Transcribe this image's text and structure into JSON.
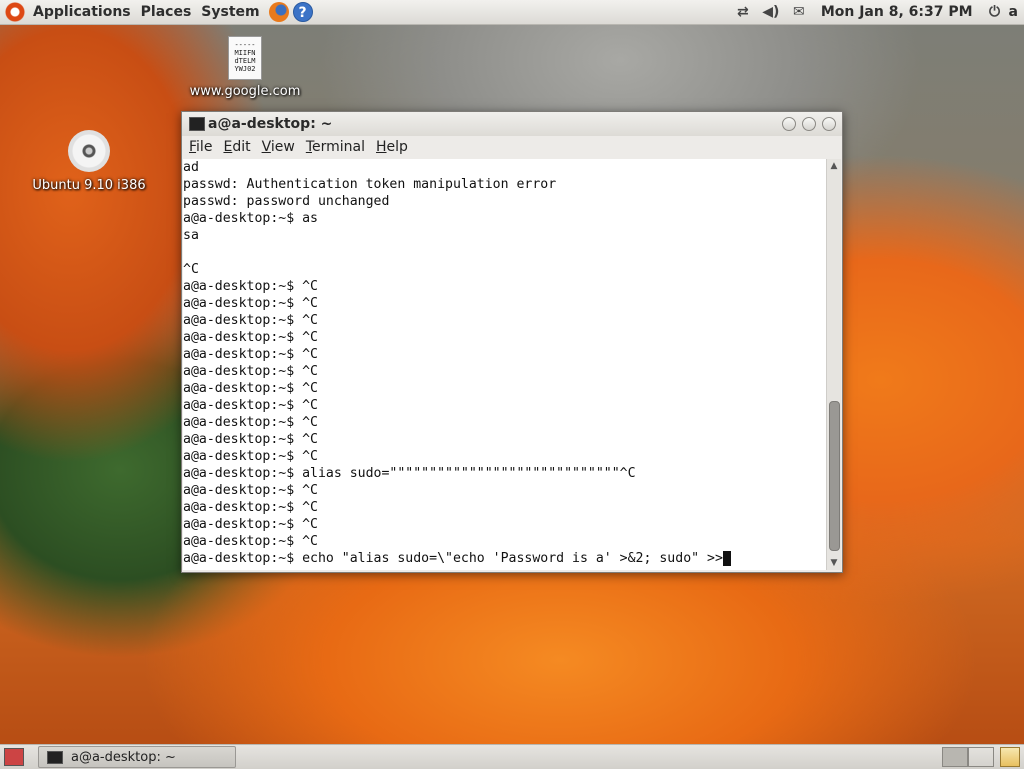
{
  "top_panel": {
    "menus": [
      "Applications",
      "Places",
      "System"
    ],
    "clock": "Mon Jan  8,  6:37 PM",
    "user": "a",
    "icons": [
      "ubuntu-logo-icon",
      "firefox-icon",
      "help-icon",
      "network-icon",
      "volume-icon",
      "mail-icon",
      "power-icon"
    ]
  },
  "desktop": {
    "file_icon": {
      "label": "www.google.com",
      "preview": [
        "-----",
        "MIIFN",
        "dTELM",
        "YWJ02"
      ]
    },
    "cd_icon": {
      "label": "Ubuntu 9.10 i386"
    }
  },
  "window": {
    "title": "a@a-desktop: ~",
    "menu": [
      "File",
      "Edit",
      "View",
      "Terminal",
      "Help"
    ],
    "lines": [
      "ad",
      "passwd: Authentication token manipulation error",
      "passwd: password unchanged",
      "a@a-desktop:~$ as",
      "sa",
      "",
      "^C",
      "a@a-desktop:~$ ^C",
      "a@a-desktop:~$ ^C",
      "a@a-desktop:~$ ^C",
      "a@a-desktop:~$ ^C",
      "a@a-desktop:~$ ^C",
      "a@a-desktop:~$ ^C",
      "a@a-desktop:~$ ^C",
      "a@a-desktop:~$ ^C",
      "a@a-desktop:~$ ^C",
      "a@a-desktop:~$ ^C",
      "a@a-desktop:~$ ^C",
      "a@a-desktop:~$ alias sudo=\"\"\"\"\"\"\"\"\"\"\"\"\"\"\"\"\"\"\"\"\"\"\"\"\"\"\"\"\"^C",
      "a@a-desktop:~$ ^C",
      "a@a-desktop:~$ ^C",
      "a@a-desktop:~$ ^C",
      "a@a-desktop:~$ ^C"
    ],
    "current_line": "a@a-desktop:~$ echo \"alias sudo=\\\"echo 'Password is a' >&2; sudo\" >>"
  },
  "bottom_panel": {
    "task_label": "a@a-desktop: ~"
  }
}
